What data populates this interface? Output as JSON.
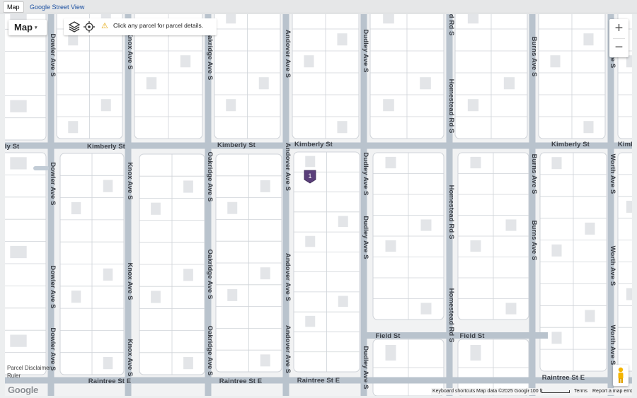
{
  "tabs": [
    {
      "label": "Map",
      "active": true
    },
    {
      "label": "Google Street View",
      "active": false
    }
  ],
  "map_type": {
    "label": "Map",
    "caret": "▾"
  },
  "tools": {
    "layers_icon": "layers-icon",
    "locate_icon": "locate-icon",
    "warning_icon": "warning-icon",
    "hint": "Click any parcel for parcel details."
  },
  "zoom": {
    "in": "+",
    "out": "−"
  },
  "street_labels": {
    "kimberly_1": "ly St",
    "kimberly_2": "Kimberly St",
    "kimberly_3": "Kimberly St",
    "kimberly_4": "Kimberly St",
    "kimberly_5": "Kimberly St",
    "kimberly_6": "Kimb",
    "raintree_1": "Raintree St E",
    "raintree_2": "Raintree St E",
    "raintree_3": "Raintree St E",
    "raintree_4": "Raintree St E",
    "field_1": "Field St",
    "field_2": "Field St",
    "dowler": "Dowler Ave S",
    "knox": "Knox Ave S",
    "oakridge": "Oakridge Ave S",
    "andover": "Andover Ave S",
    "dudley": "Dudley Ave S",
    "homestead": "Homestead Rd S",
    "burns": "Burns Ave S",
    "worth": "Worth Ave S"
  },
  "marker": {
    "label": "1",
    "color": "#5a3f7a"
  },
  "left_notes": {
    "disclaimer": "Parcel Disclaimer",
    "ruler": "Ruler"
  },
  "google_logo": "Google",
  "footer": {
    "shortcuts": "Keyboard shortcuts",
    "map_data": "Map data ©2025 Google",
    "scale": "100 ft",
    "terms": "Terms",
    "report": "Report a map error"
  },
  "colors": {
    "road": "#b9c3cd",
    "parcel_fill": "#ffffff",
    "parcel_line": "#cfd3d8",
    "building": "#e3e5e8",
    "background": "#f1f2f3"
  }
}
